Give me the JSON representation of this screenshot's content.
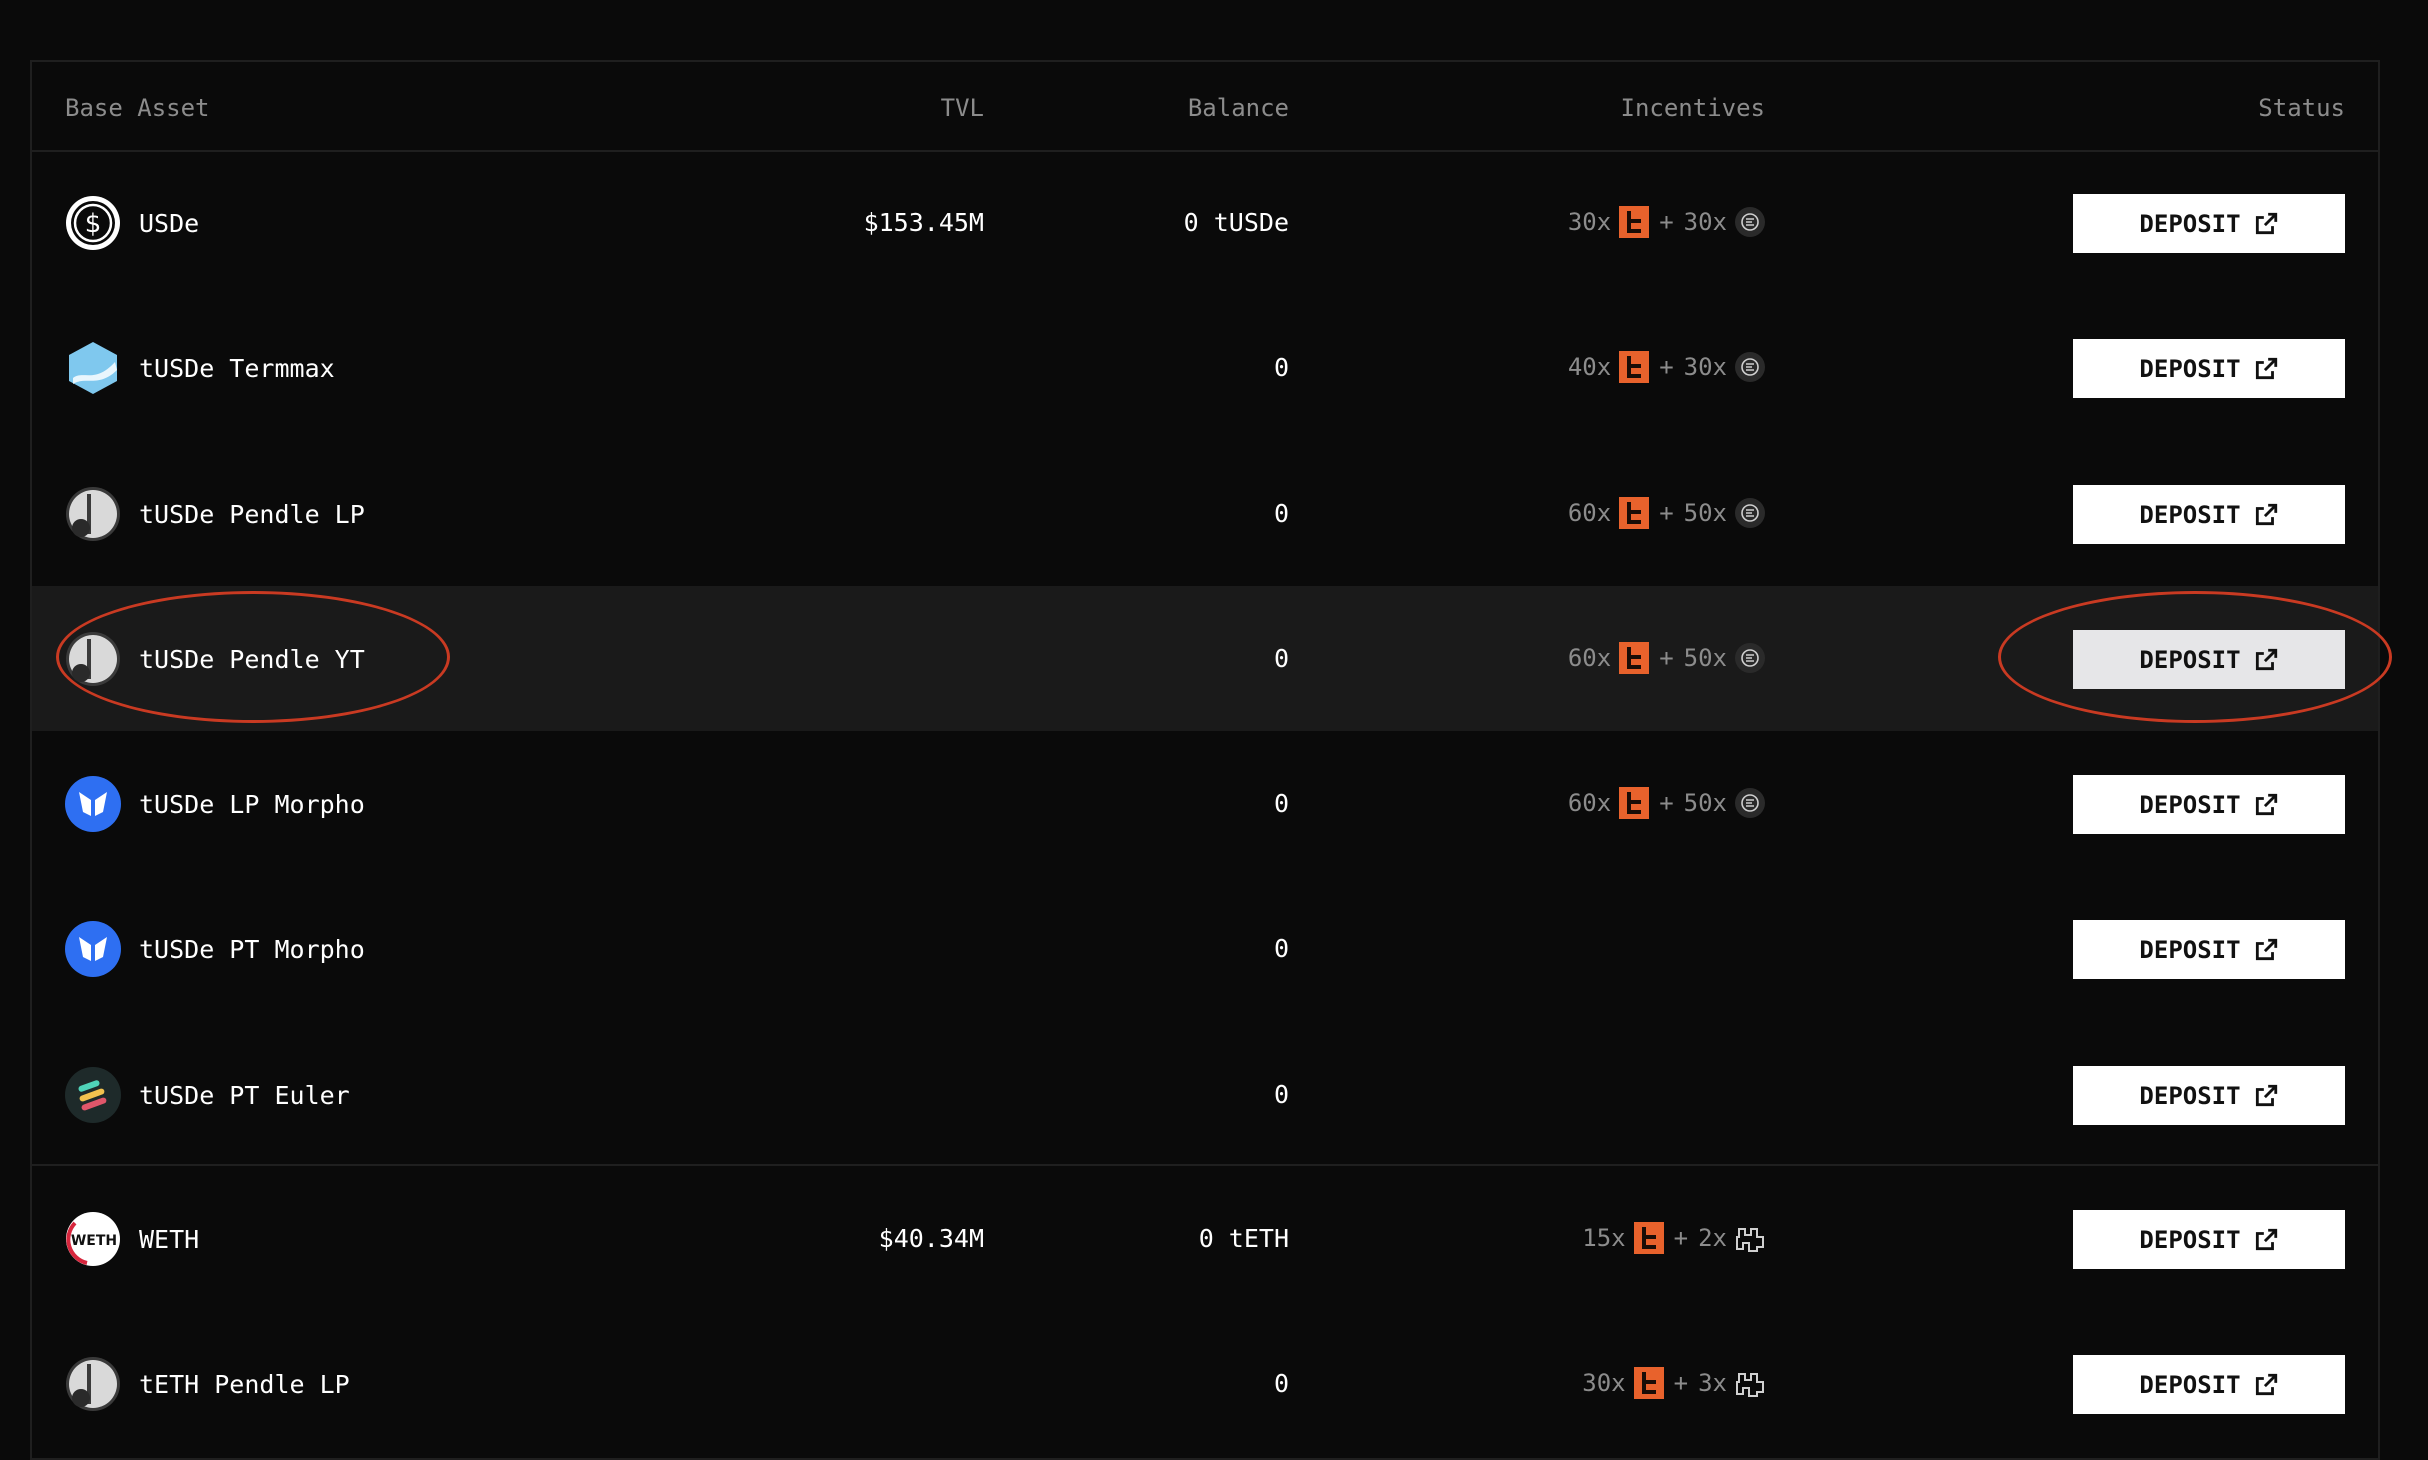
{
  "header": {
    "base_asset": "Base Asset",
    "tvl": "TVL",
    "balance": "Balance",
    "incentives": "Incentives",
    "status": "Status"
  },
  "colors": {
    "background": "#0a0a0a",
    "highlight_row": "#1a1a1a",
    "accent_orange": "#e8622c",
    "annotation_red": "#c93a22"
  },
  "rows": [
    {
      "name": "USDe",
      "icon": "usde-dollar-icon",
      "tvl": "$153.45M",
      "balance": "0 tUSDe",
      "incentives": {
        "a": "30x",
        "b": "30x",
        "partner_icon": "ethena-icon"
      },
      "action": "DEPOSIT"
    },
    {
      "name": "tUSDe Termmax",
      "icon": "termmax-icon",
      "tvl": "",
      "balance": "0",
      "incentives": {
        "a": "40x",
        "b": "30x",
        "partner_icon": "ethena-icon"
      },
      "action": "DEPOSIT"
    },
    {
      "name": "tUSDe Pendle LP",
      "icon": "pendle-icon",
      "tvl": "",
      "balance": "0",
      "incentives": {
        "a": "60x",
        "b": "50x",
        "partner_icon": "ethena-icon"
      },
      "action": "DEPOSIT"
    },
    {
      "name": "tUSDe Pendle YT",
      "icon": "pendle-icon",
      "tvl": "",
      "balance": "0",
      "incentives": {
        "a": "60x",
        "b": "50x",
        "partner_icon": "ethena-icon"
      },
      "action": "DEPOSIT",
      "highlighted": true
    },
    {
      "name": "tUSDe LP Morpho",
      "icon": "morpho-icon",
      "tvl": "",
      "balance": "0",
      "incentives": {
        "a": "60x",
        "b": "50x",
        "partner_icon": "ethena-icon"
      },
      "action": "DEPOSIT"
    },
    {
      "name": "tUSDe PT Morpho",
      "icon": "morpho-icon",
      "tvl": "",
      "balance": "0",
      "incentives": null,
      "action": "DEPOSIT"
    },
    {
      "name": "tUSDe PT Euler",
      "icon": "euler-icon",
      "tvl": "",
      "balance": "0",
      "incentives": null,
      "action": "DEPOSIT"
    },
    {
      "name": "WETH",
      "icon": "weth-icon",
      "tvl": "$40.34M",
      "balance": "0 tETH",
      "incentives": {
        "a": "15x",
        "b": "2x",
        "partner_icon": "eigen-icon"
      },
      "action": "DEPOSIT"
    },
    {
      "name": "tETH Pendle LP",
      "icon": "pendle-icon",
      "tvl": "",
      "balance": "0",
      "incentives": {
        "a": "30x",
        "b": "3x",
        "partner_icon": "eigen-icon"
      },
      "action": "DEPOSIT"
    }
  ]
}
